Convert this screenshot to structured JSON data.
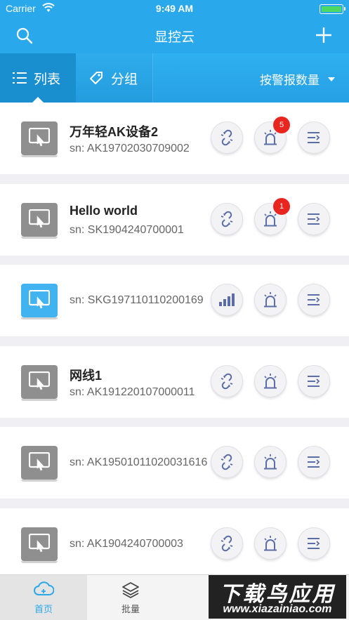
{
  "status_bar": {
    "carrier": "Carrier",
    "time": "9:49 AM"
  },
  "nav": {
    "title": "显控云"
  },
  "tabs": {
    "list_label": "列表",
    "group_label": "分组",
    "sort_label": "按警报数量"
  },
  "devices": [
    {
      "name": "万年轻AK设备2",
      "sn": "sn: AK19702030709002",
      "online": false,
      "alarm_count": "5"
    },
    {
      "name": "Hello world",
      "sn": "sn: SK1904240700001",
      "online": false,
      "alarm_count": "1"
    },
    {
      "name": "",
      "sn": "sn: SKG197110110200169",
      "online": true,
      "alarm_count": ""
    },
    {
      "name": "网线1",
      "sn": "sn: AK191220107000011",
      "online": false,
      "alarm_count": ""
    },
    {
      "name": "",
      "sn": "sn: AK19501011020031616",
      "online": false,
      "alarm_count": ""
    },
    {
      "name": "",
      "sn": "sn: AK1904240700003",
      "online": false,
      "alarm_count": ""
    }
  ],
  "bottom_tabs": {
    "home": "首页",
    "batch": "批量"
  },
  "watermark": {
    "top": "下载鸟应用",
    "bottom": "www.xiazainiao.com"
  },
  "colors": {
    "accent": "#2aa8ec",
    "badge": "#e8261f",
    "offline_icon": "#8f8f8f",
    "online_icon": "#41b3f0"
  }
}
